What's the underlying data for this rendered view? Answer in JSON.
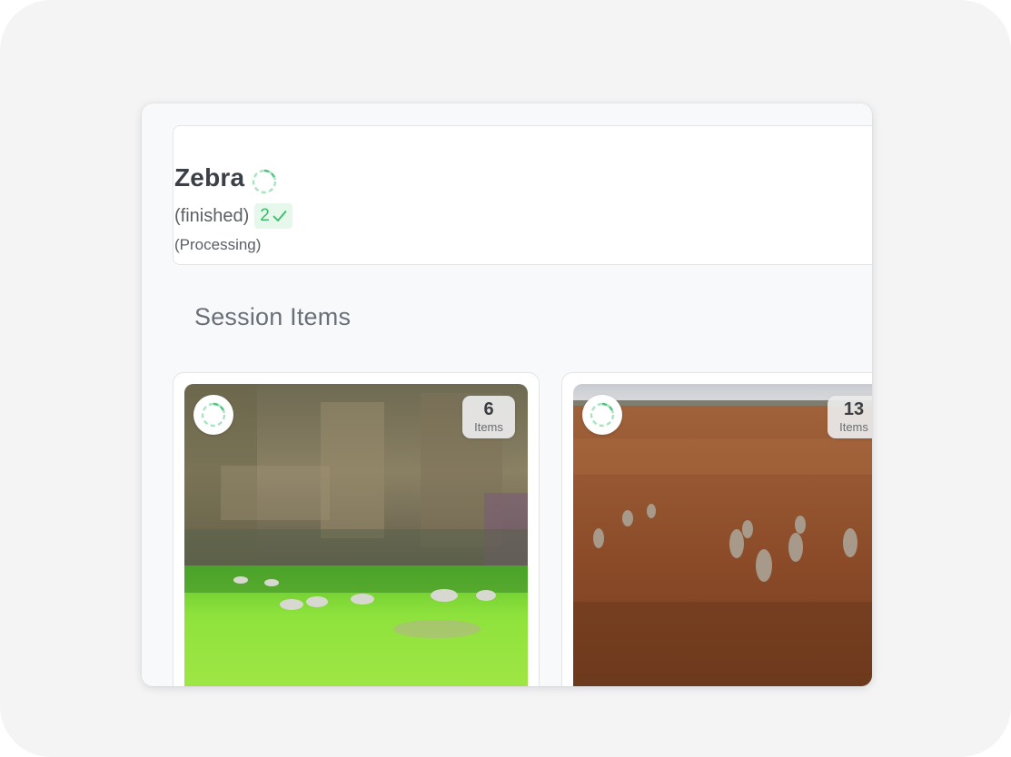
{
  "header": {
    "title": "Zebra",
    "status": "(finished)",
    "finished_count": "2",
    "processing": "(Processing)"
  },
  "section": {
    "title": "Session Items"
  },
  "cards": [
    {
      "count": "6",
      "label": "Items"
    },
    {
      "count": "13",
      "label": "Items"
    }
  ],
  "colors": {
    "accent_green": "#3cba6b",
    "badge_bg": "#e6f7ec"
  },
  "icons": {
    "spinner": "loading-spinner-icon",
    "check": "check-icon"
  }
}
